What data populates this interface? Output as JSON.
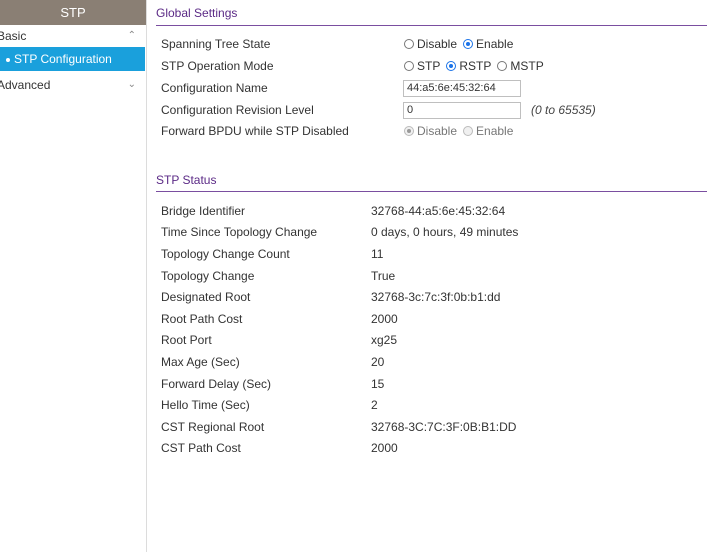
{
  "sidebar": {
    "title": "STP",
    "groups": [
      {
        "label": "Basic",
        "items": [
          {
            "label": "STP Configuration",
            "active": true
          }
        ]
      },
      {
        "label": "Advanced",
        "items": []
      }
    ]
  },
  "global_settings": {
    "title": "Global Settings",
    "spanning_tree_state": {
      "label": "Spanning Tree State",
      "options": [
        "Disable",
        "Enable"
      ],
      "selected": "Enable"
    },
    "operation_mode": {
      "label": "STP Operation Mode",
      "options": [
        "STP",
        "RSTP",
        "MSTP"
      ],
      "selected": "RSTP"
    },
    "config_name": {
      "label": "Configuration Name",
      "value": "44:a5:6e:45:32:64"
    },
    "revision_level": {
      "label": "Configuration Revision Level",
      "value": "0",
      "range": "(0 to 65535)"
    },
    "forward_bpdu": {
      "label": "Forward BPDU while STP Disabled",
      "options": [
        "Disable",
        "Enable"
      ],
      "selected": "Disable",
      "disabled": true
    }
  },
  "stp_status": {
    "title": "STP Status",
    "rows": [
      {
        "label": "Bridge Identifier",
        "value": "32768-44:a5:6e:45:32:64"
      },
      {
        "label": "Time Since Topology Change",
        "value": "0 days, 0 hours, 49 minutes"
      },
      {
        "label": "Topology Change Count",
        "value": "11"
      },
      {
        "label": "Topology Change",
        "value": "True"
      },
      {
        "label": "Designated Root",
        "value": "32768-3c:7c:3f:0b:b1:dd"
      },
      {
        "label": "Root Path Cost",
        "value": "2000"
      },
      {
        "label": "Root Port",
        "value": "xg25"
      },
      {
        "label": "Max Age (Sec)",
        "value": "20"
      },
      {
        "label": "Forward Delay (Sec)",
        "value": "15"
      },
      {
        "label": "Hello Time (Sec)",
        "value": "2"
      },
      {
        "label": "CST Regional Root",
        "value": "32768-3C:7C:3F:0B:B1:DD"
      },
      {
        "label": "CST Path Cost",
        "value": "2000"
      }
    ]
  },
  "colors": {
    "sidebar_header": "#8a7f74",
    "active_item": "#1aa0dc",
    "section_accent": "#5b2a86"
  }
}
